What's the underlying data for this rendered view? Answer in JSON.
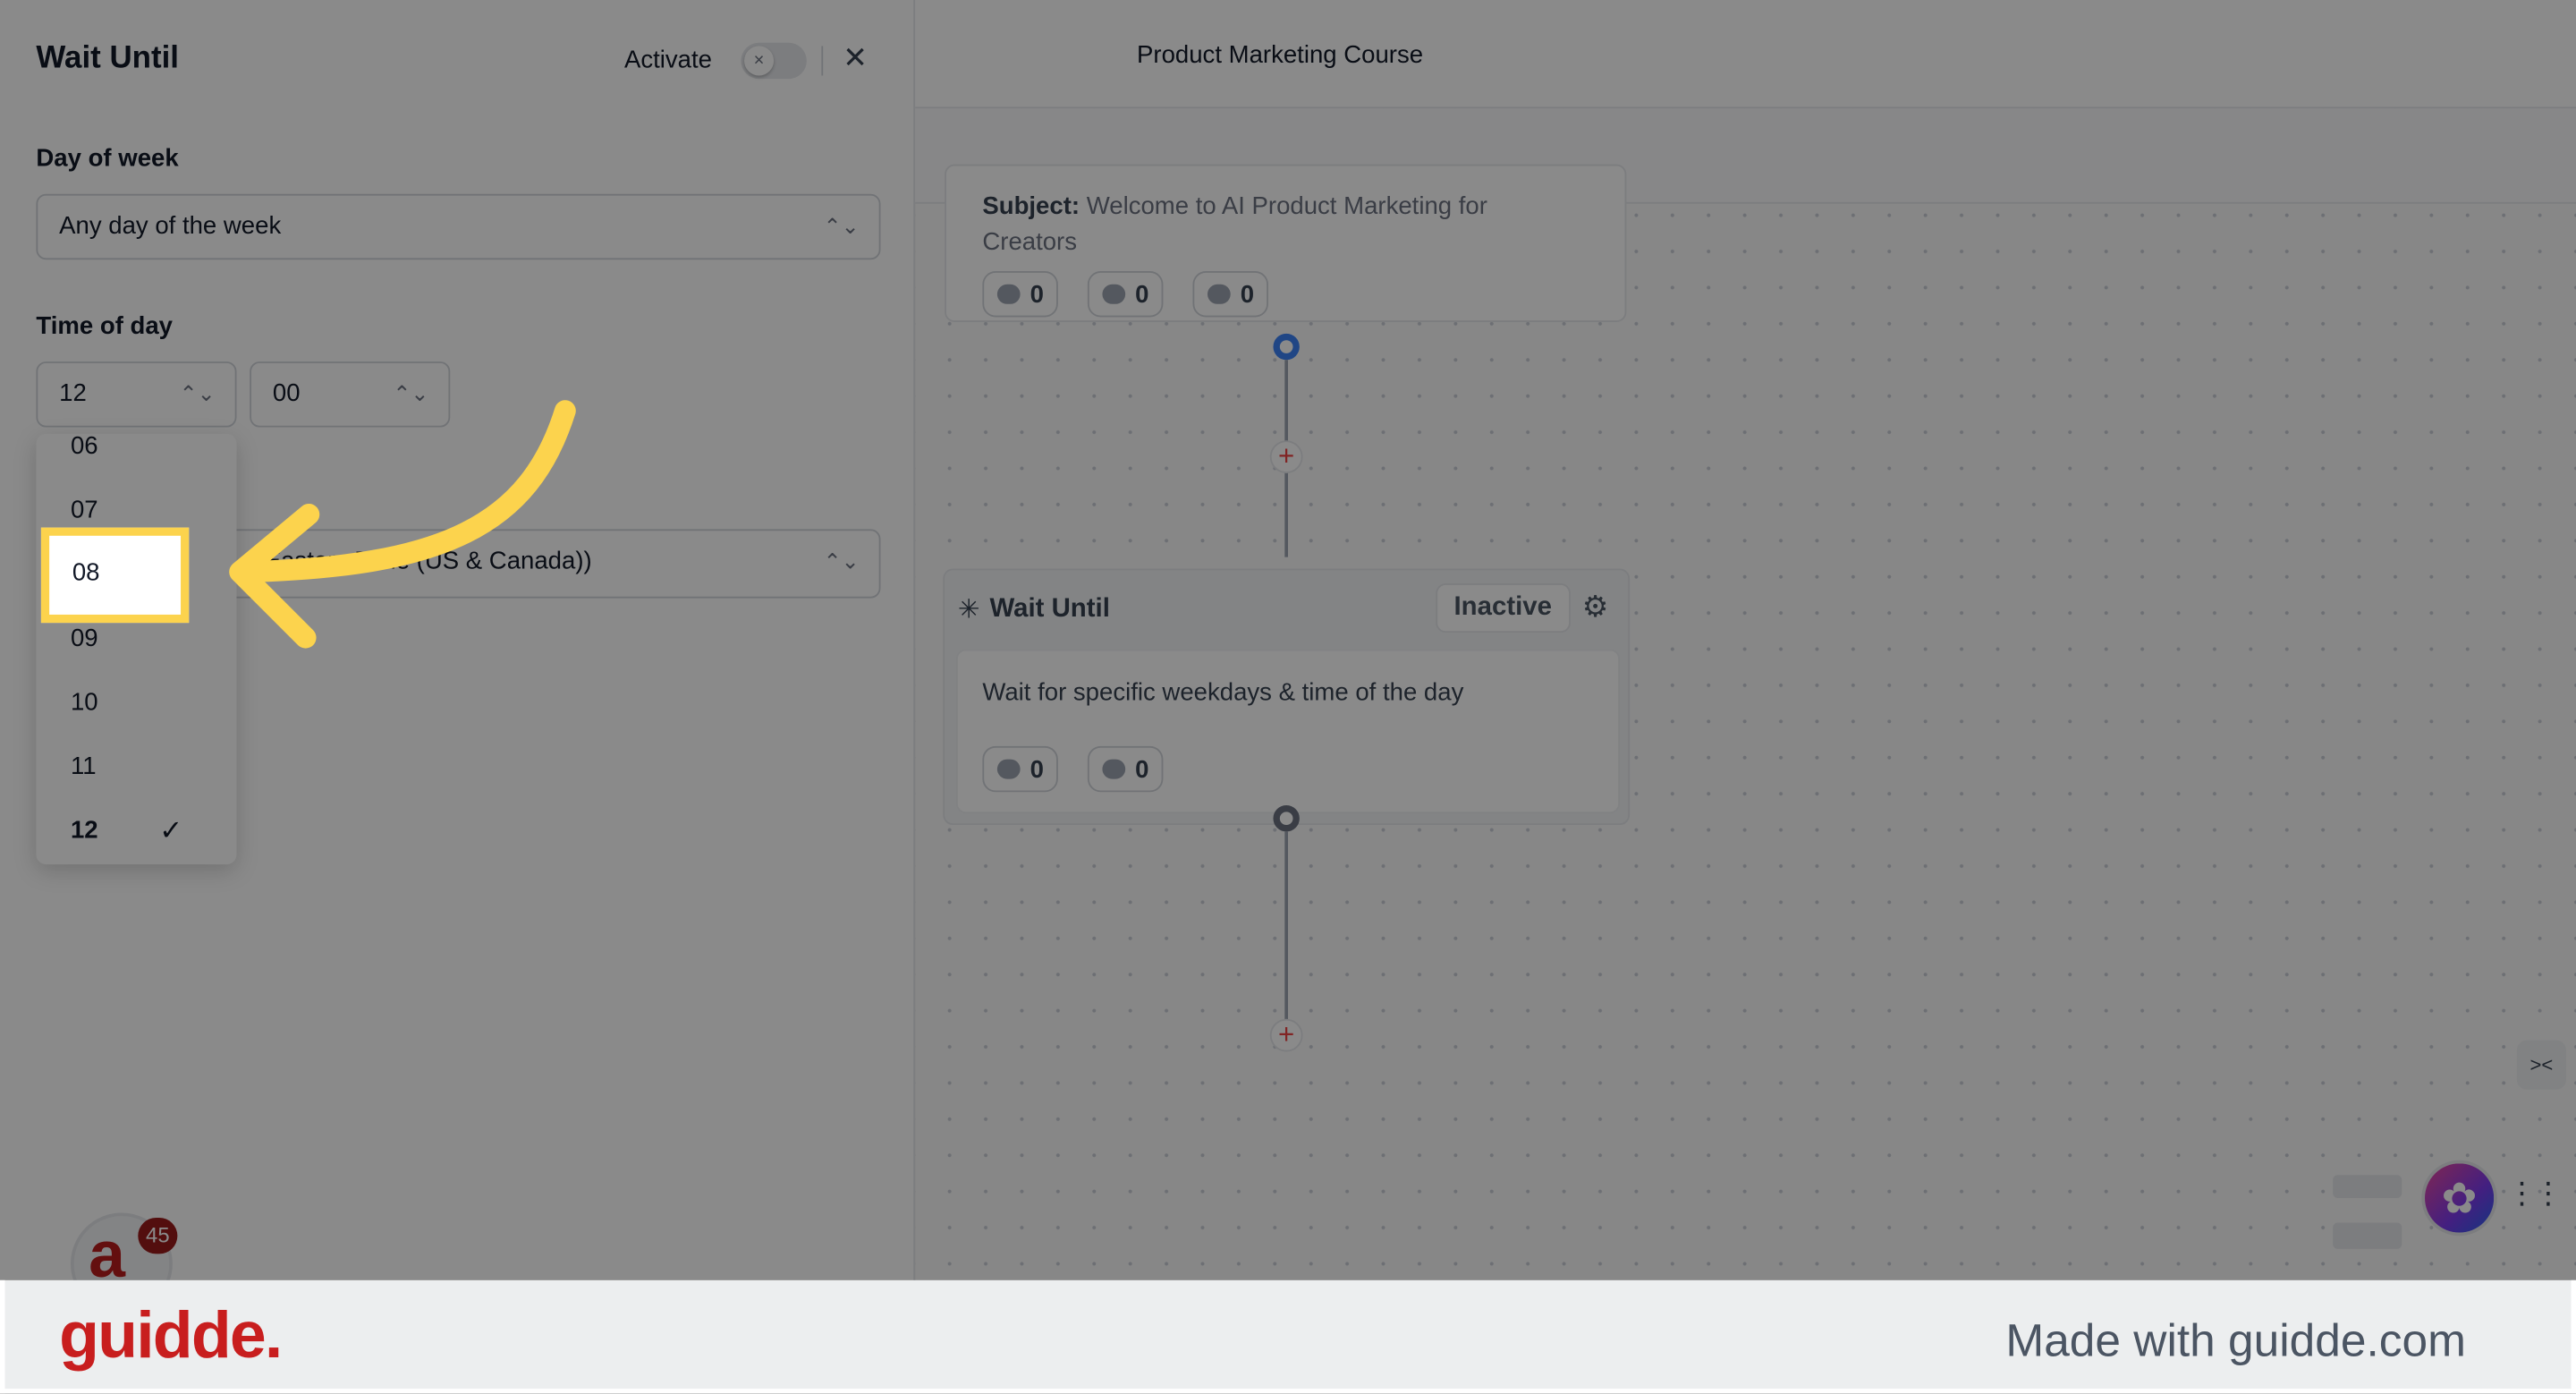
{
  "panel": {
    "title": "Wait Until",
    "activate_label": "Activate",
    "day_of_week_label": "Day of week",
    "day_of_week_value": "Any day of the week",
    "time_of_day_label": "Time of day",
    "hour_value": "12",
    "minute_value": "00",
    "timezone_value": "Eastern Time (US & Canada))",
    "hour_options": [
      "06",
      "07",
      "08",
      "09",
      "10",
      "11",
      "12"
    ],
    "highlighted_option": "08",
    "selected_option": "12"
  },
  "canvas": {
    "title": "Product Marketing Course",
    "email_node": {
      "subject_label": "Subject:",
      "subject_text": "Welcome to AI Product Marketing for Creators",
      "stat_1": "0",
      "stat_2": "0",
      "stat_3": "0"
    },
    "wait_node": {
      "title": "Wait Until",
      "status": "Inactive",
      "description": "Wait for specific weekdays & time of the day",
      "stat_users": "0",
      "stat_done": "0"
    }
  },
  "widget": {
    "badge_count": "45"
  },
  "footer": {
    "brand": "guidde.",
    "made_with": "Made with guidde.com"
  },
  "colors": {
    "highlight": "#fcd34d",
    "arrow": "#fcd34d",
    "brand_red": "#c81e1e",
    "node_blue": "#3b82f6"
  }
}
